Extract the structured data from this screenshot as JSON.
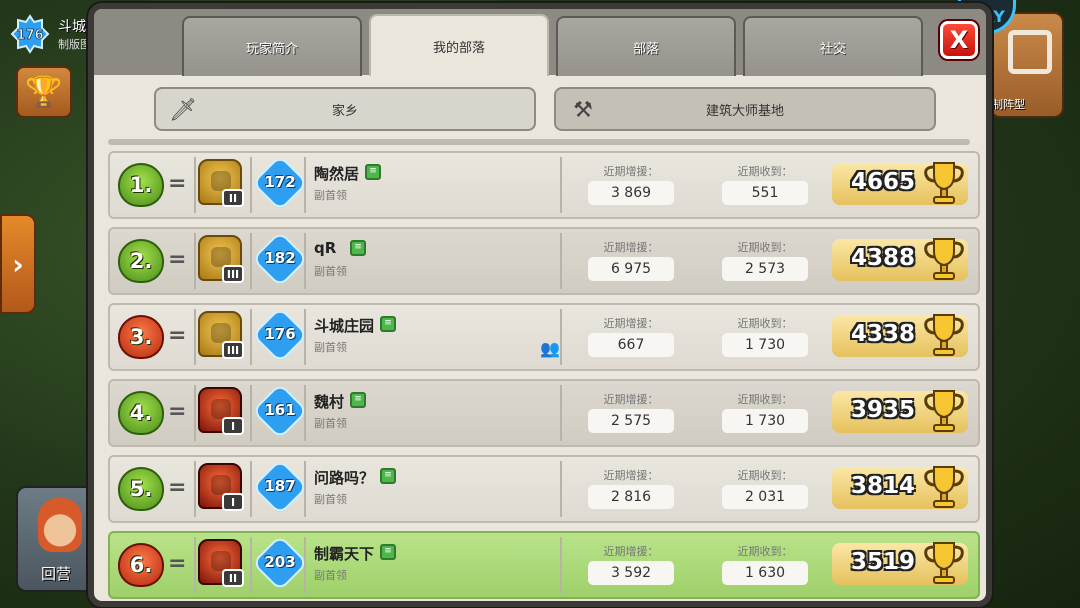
{
  "background": {
    "player_level": "176",
    "player_name_fragment": "斗城",
    "player_sub_fragment": "制版图",
    "hero_label": "回营",
    "right_button_label": "制阵型",
    "corner_badge": "DAY"
  },
  "tabs": [
    {
      "label": "玩家简介"
    },
    {
      "label": "我的部落"
    },
    {
      "label": "部落"
    },
    {
      "label": "社交"
    }
  ],
  "active_tab": "我的部落",
  "close_label": "X",
  "subtabs": [
    {
      "label": "家乡",
      "icon": "sword-icon"
    },
    {
      "label": "建筑大师基地",
      "icon": "crossed-axes-icon"
    }
  ],
  "stat_labels": {
    "donated": "近期增援：",
    "received": "近期收到："
  },
  "members": [
    {
      "rank": "1.",
      "league": "green",
      "change": "=",
      "townhall": "gold",
      "th_level": "II",
      "xp": "172",
      "name": "陶然居",
      "role": "副首领",
      "donated": "3 869",
      "received": "551",
      "trophies": "4665",
      "friend": false,
      "mine": false
    },
    {
      "rank": "2.",
      "league": "green",
      "change": "=",
      "townhall": "gold",
      "th_level": "III",
      "xp": "182",
      "name": "qR",
      "role": "副首领",
      "donated": "6 975",
      "received": "2 573",
      "trophies": "4388",
      "friend": false,
      "mine": false
    },
    {
      "rank": "3.",
      "league": "red",
      "change": "=",
      "townhall": "gold",
      "th_level": "III",
      "xp": "176",
      "name": "斗城庄园",
      "role": "副首领",
      "donated": "667",
      "received": "1 730",
      "trophies": "4338",
      "friend": true,
      "mine": false
    },
    {
      "rank": "4.",
      "league": "green",
      "change": "=",
      "townhall": "lava",
      "th_level": "I",
      "xp": "161",
      "name": "魏村",
      "role": "副首领",
      "donated": "2 575",
      "received": "1 730",
      "trophies": "3935",
      "friend": false,
      "mine": false
    },
    {
      "rank": "5.",
      "league": "green",
      "change": "=",
      "townhall": "lava",
      "th_level": "I",
      "xp": "187",
      "name": "问路吗？",
      "role": "副首领",
      "donated": "2 816",
      "received": "2 031",
      "trophies": "3814",
      "friend": false,
      "mine": false
    },
    {
      "rank": "6.",
      "league": "red",
      "change": "=",
      "townhall": "lava",
      "th_level": "II",
      "xp": "203",
      "name": "制霸天下",
      "role": "副首领",
      "donated": "3 592",
      "received": "1 630",
      "trophies": "3519",
      "friend": false,
      "mine": true
    }
  ]
}
